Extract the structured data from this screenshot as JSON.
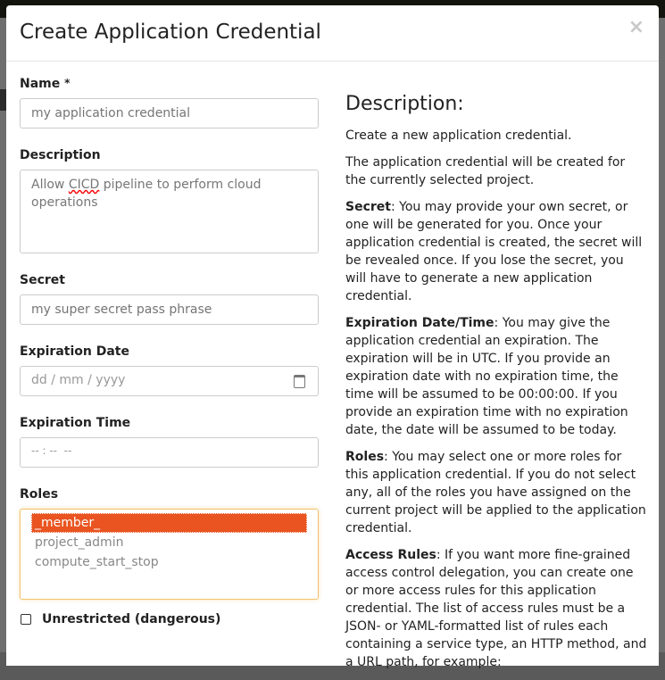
{
  "modal": {
    "title": "Create Application Credential",
    "close": "×"
  },
  "form": {
    "name": {
      "label": "Name",
      "required": "*",
      "placeholder": "my application credential"
    },
    "description": {
      "label": "Description",
      "value_pre": "Allow ",
      "value_spell": "CICD",
      "value_post": " pipeline to perform cloud operations"
    },
    "secret": {
      "label": "Secret",
      "placeholder": "my super secret pass phrase"
    },
    "expiration_date": {
      "label": "Expiration Date",
      "placeholder": "dd / mm / yyyy"
    },
    "expiration_time": {
      "label": "Expiration Time",
      "placeholder": "-- : --  --"
    },
    "roles": {
      "label": "Roles",
      "options": [
        "_member_",
        "project_admin",
        "compute_start_stop"
      ],
      "selected": "_member_"
    },
    "unrestricted": {
      "label": "Unrestricted (dangerous)",
      "checked": false
    }
  },
  "help": {
    "title": "Description:",
    "p1": "Create a new application credential.",
    "p2": "The application credential will be created for the currently selected project.",
    "secret_term": "Secret",
    "secret_text": ": You may provide your own secret, or one will be generated for you. Once your application credential is created, the secret will be revealed once. If you lose the secret, you will have to generate a new application credential.",
    "exp_term": "Expiration Date/Time",
    "exp_text": ": You may give the application credential an expiration. The expiration will be in UTC. If you provide an expiration date with no expiration time, the time will be assumed to be 00:00:00. If you provide an expiration time with no expiration date, the date will be assumed to be today.",
    "roles_term": "Roles",
    "roles_text": ": You may select one or more roles for this application credential. If you do not select any, all of the roles you have assigned on the current project will be applied to the application credential.",
    "rules_term": "Access Rules",
    "rules_text": ": If you want more fine-grained access control delegation, you can create one or more access rules for this application credential. The list of access rules must be a JSON- or YAML-formatted list of rules each containing a service type, an HTTP method, and a URL path, for example:"
  },
  "colors": {
    "accent": "#e95420",
    "focus_border": "#f0c36d"
  }
}
